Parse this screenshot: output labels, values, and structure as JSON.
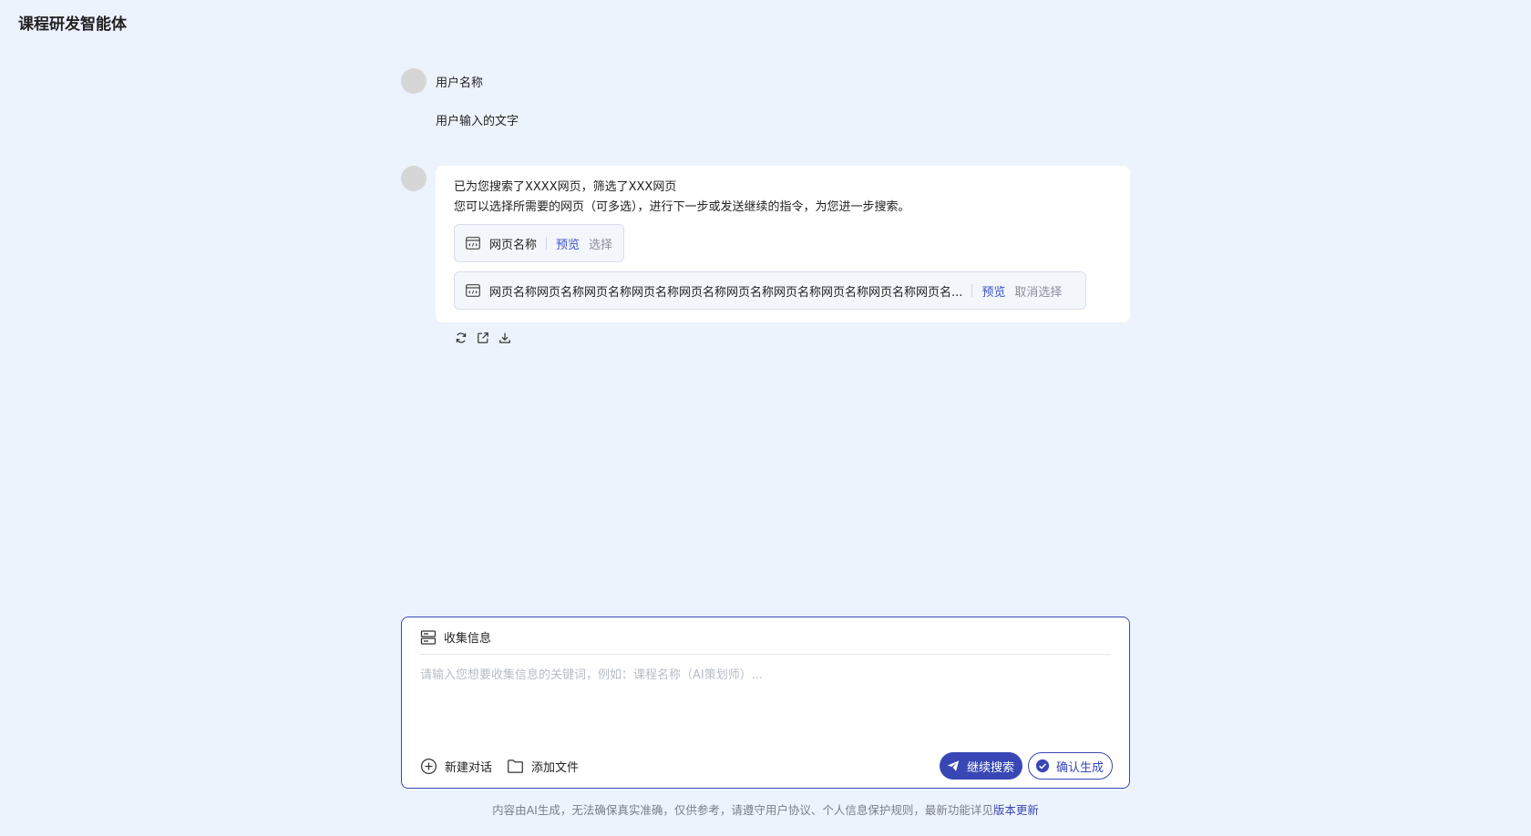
{
  "app": {
    "title": "课程研发智能体"
  },
  "conversation": {
    "user": {
      "name": "用户名称",
      "message": "用户输入的文字"
    },
    "assistant": {
      "line1": "已为您搜索了XXXX网页，筛选了XXX网页",
      "line2": "您可以选择所需要的网页（可多选），进行下一步或发送继续的指令，为您进一步搜索。",
      "results": [
        {
          "name": "网页名称",
          "preview_label": "预览",
          "action_label": "选择"
        },
        {
          "name": "网页名称网页名称网页名称网页名称网页名称网页名称网页名称网页名称网页名称网页名...",
          "preview_label": "预览",
          "action_label": "取消选择"
        }
      ],
      "actions": [
        "refresh-icon",
        "share-icon",
        "download-icon"
      ]
    }
  },
  "composer": {
    "mode_label": "收集信息",
    "placeholder": "请输入您想要收集信息的关键词，例如：课程名称（AI策划师）...",
    "new_chat_label": "新建对话",
    "add_file_label": "添加文件",
    "continue_search_label": "继续搜索",
    "confirm_generate_label": "确认生成"
  },
  "footer": {
    "disclaimer": "内容由AI生成，无法确保真实准确，仅供参考，请遵守用户协议、个人信息保护规则，最新功能详见",
    "link_label": "版本更新"
  },
  "colors": {
    "background": "#edf3fd",
    "accent": "#3847b5",
    "card": "#ffffff"
  }
}
